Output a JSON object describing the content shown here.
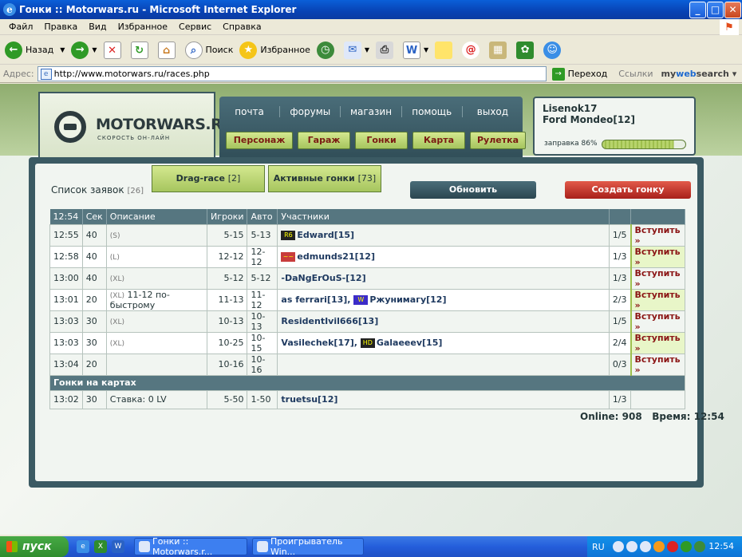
{
  "window": {
    "title": "Гонки :: Motorwars.ru - Microsoft Internet Explorer",
    "min": "_",
    "max": "□",
    "close": "✕"
  },
  "menu": [
    "Файл",
    "Правка",
    "Вид",
    "Избранное",
    "Сервис",
    "Справка"
  ],
  "toolbar": {
    "back": "Назад",
    "search": "Поиск",
    "favorites": "Избранное"
  },
  "address": {
    "label": "Адрес:",
    "url": "http://www.motorwars.ru/races.php",
    "go": "Переход",
    "links": "Ссылки",
    "mws_a": "my",
    "mws_b": "web",
    "mws_c": "search"
  },
  "site": {
    "logo": "MOTORWARS.RU",
    "logo_sub": "СКОРОСТЬ ОН-ЛАЙН",
    "nav_top": [
      "почта",
      "форумы",
      "магазин",
      "помощь",
      "выход"
    ],
    "nav_bottom": [
      "Персонаж",
      "Гараж",
      "Гонки",
      "Карта",
      "Рулетка"
    ],
    "user": {
      "name": "Lisenok17",
      "car": "Ford Mondeo[12]",
      "fuel": "заправка 86%",
      "fuel_pct": 86
    }
  },
  "races": {
    "list_label": "Список заявок",
    "list_count": "[26]",
    "tabs": [
      {
        "label": "Drag-race",
        "count": "[2]"
      },
      {
        "label": "Активные гонки",
        "count": "[73]"
      }
    ],
    "refresh": "Обновить",
    "create": "Создать гонку",
    "headers": [
      "12:54",
      "Сек",
      "Описание",
      "Игроки",
      "Авто",
      "Участники"
    ],
    "rows": [
      {
        "time": "12:55",
        "sec": "40",
        "sub": "(S)",
        "desc": "",
        "players": "5-15",
        "auto": "5-13",
        "badge": "R6",
        "badge_color": "#222",
        "members": "Edward[15]",
        "slots": "1/5",
        "join": "Вступить »"
      },
      {
        "time": "12:58",
        "sec": "40",
        "sub": "(L)",
        "desc": "",
        "players": "12-12",
        "auto": "12-12",
        "badge": "~~",
        "badge_color": "#c83c3c",
        "members": "edmunds21[12]",
        "slots": "1/3",
        "join": "Вступить »"
      },
      {
        "time": "13:00",
        "sec": "40",
        "sub": "(XL)",
        "desc": "",
        "players": "5-12",
        "auto": "5-12",
        "badge": "",
        "badge_color": "",
        "members": "-DaNgErOuS-[12]",
        "slots": "1/3",
        "join": "Вступить »"
      },
      {
        "time": "13:01",
        "sec": "20",
        "sub": "(XL)",
        "desc": "11-12 по-быстрому",
        "players": "11-13",
        "auto": "11-12",
        "badge": "",
        "badge_color": "",
        "members": "as ferrari[13], ",
        "badge2": "W",
        "badge2_color": "#3c2cc8",
        "members2": "Ржунимагу[12]",
        "slots": "2/3",
        "join": "Вступить »"
      },
      {
        "time": "13:03",
        "sec": "30",
        "sub": "(XL)",
        "desc": "",
        "players": "10-13",
        "auto": "10-13",
        "badge": "",
        "badge_color": "",
        "members": "ResidentIvil666[13]",
        "slots": "1/5",
        "join": "Вступить »"
      },
      {
        "time": "13:03",
        "sec": "30",
        "sub": "(XL)",
        "desc": "",
        "players": "10-25",
        "auto": "10-15",
        "badge": "",
        "badge_color": "",
        "members": "Vasilechek[17], ",
        "badge2": "HD",
        "badge2_color": "#222",
        "members2": "Galaeeev[15]",
        "slots": "2/4",
        "join": "Вступить »"
      },
      {
        "time": "13:04",
        "sec": "20",
        "sub": "",
        "desc": "",
        "players": "10-16",
        "auto": "10-16",
        "badge": "",
        "badge_color": "",
        "members": "",
        "slots": "0/3",
        "join": "Вступить »"
      }
    ],
    "map_section": "Гонки на картах",
    "map_row": {
      "time": "13:02",
      "sec": "30",
      "desc": "Ставка: 0 LV",
      "players": "5-50",
      "auto": "1-50",
      "members": "truetsu[12]",
      "slots": "1/3"
    },
    "online": "Online: 908",
    "server_time": "Время: 12:54"
  },
  "taskbar": {
    "start": "пуск",
    "tasks": [
      "Гонки :: Motorwars.r...",
      "Проигрыватель Win..."
    ],
    "lang": "RU",
    "clock": "12:54"
  }
}
